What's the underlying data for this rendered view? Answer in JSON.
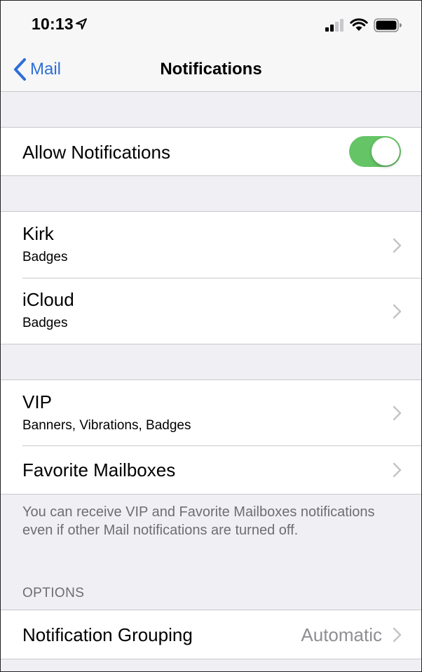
{
  "status_bar": {
    "time": "10:13",
    "icons": [
      "location-arrow-icon",
      "signal-icon",
      "wifi-icon",
      "battery-icon"
    ]
  },
  "nav": {
    "back_label": "Mail",
    "title": "Notifications"
  },
  "allow_notifications": {
    "label": "Allow Notifications",
    "enabled": true
  },
  "accounts": [
    {
      "title": "Kirk",
      "subtitle": "Badges"
    },
    {
      "title": "iCloud",
      "subtitle": "Badges"
    }
  ],
  "vip_section": {
    "items": [
      {
        "title": "VIP",
        "subtitle": "Banners, Vibrations, Badges"
      },
      {
        "title": "Favorite Mailboxes"
      }
    ],
    "footer": "You can receive VIP and Favorite Mailboxes notifications even if other Mail notifications are turned off."
  },
  "options": {
    "header": "OPTIONS",
    "grouping_label": "Notification Grouping",
    "grouping_value": "Automatic"
  },
  "colors": {
    "accent": "#2f6fd6",
    "toggle_on": "#65c466",
    "grouped_background": "#efeff4",
    "secondary_text": "#6d6d72"
  }
}
